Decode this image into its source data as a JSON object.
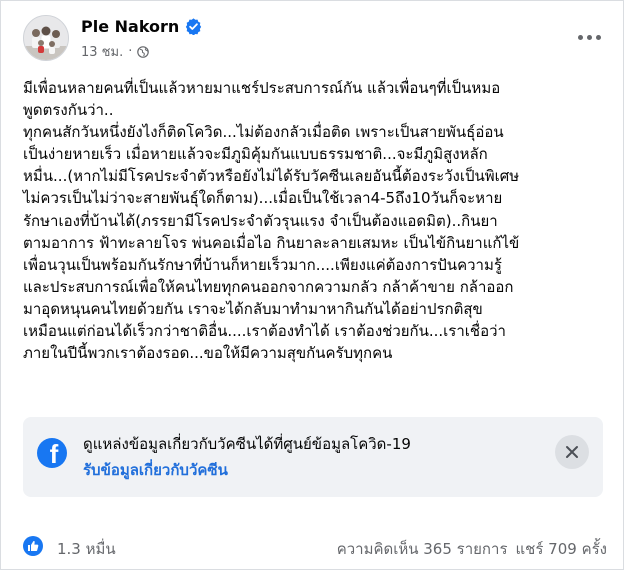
{
  "post": {
    "author": "Ple Nakorn",
    "time": "13 ชม.",
    "separator": "·",
    "lines": [
      "มีเพื่อนหลายคนที่เป็นแล้วหายมาแชร์ประสบการณ์กัน แล้วเพื่อนๆที่เป็นหมอ",
      "พูดตรงกันว่า..",
      "ทุกคนสักวันหนึ่งยังไงก็ติดโควิด...ไม่ต้องกลัวเมื่อติด เพราะเป็นสายพันธุ์อ่อน",
      "เป็นง่ายหายเร็ว เมื่อหายแล้วจะมีภูมิคุ้มกันแบบธรรมชาติ...จะมีภูมิสูงหลัก",
      "หมื่น...(หากไม่มีโรคประจำตัวหรือยังไม่ได้รับวัคซีนเลยอันนี้ต้องระวังเป็นพิเศษ",
      "ไม่ควรเป็นไม่ว่าจะสายพันธุ์ใดก็ตาม)...เมื่อเป็นใช้เวลา4-5ถึง10วันก็จะหาย",
      "รักษาเองที่บ้านได้(ภรรยามีโรคประจำตัวรุนแรง จำเป็นต้องแอดมิต)..กินยา",
      "ตามอาการ ฟ้าทะลายโจร พ่นคอเมื่อไอ กินยาละลายเสมหะ เป็นไข้กินยาแก้ไข้",
      "เพื่อนวุนเป็นพร้อมกันรักษาที่บ้านก็หายเร็วมาก....เพียงแค่ต้องการปันความรู้",
      "และประสบการณ์เพื่อให้คนไทยทุกคนออกจากความกลัว กล้าค้าขาย กล้าออก",
      "มาอุดหนุนคนไทยด้วยกัน เราจะได้กลับมาทำมาหากินกันได้อย่าปรกติสุข",
      "เหมือนแต่ก่อนได้เร็วกว่าชาติอื่น....เราต้องทำได้ เราต้องช่วยกัน...เราเชื่อว่า",
      "ภายในปีนี้พวกเราต้องรอด...ขอให้มีความสุขกันครับทุกคน"
    ]
  },
  "info_box": {
    "text": "ดูแหล่งข้อมูลเกี่ยวกับวัคซีนได้ที่ศูนย์ข้อมูลโควิด-19",
    "link": "รับข้อมูลเกี่ยวกับวัคซีน"
  },
  "footer": {
    "likes": "1.3 หมื่น",
    "comments": "ความคิดเห็น 365 รายการ",
    "shares": "แชร์ 709 ครั้ง"
  },
  "colors": {
    "brand": "#1877f2",
    "link": "#216fdb",
    "secondary_text": "#65676b",
    "info_bg": "#f0f2f5"
  },
  "icons": [
    "verified-badge-icon",
    "globe-icon",
    "more-options-icon",
    "facebook-logo-icon",
    "close-icon",
    "like-icon"
  ]
}
